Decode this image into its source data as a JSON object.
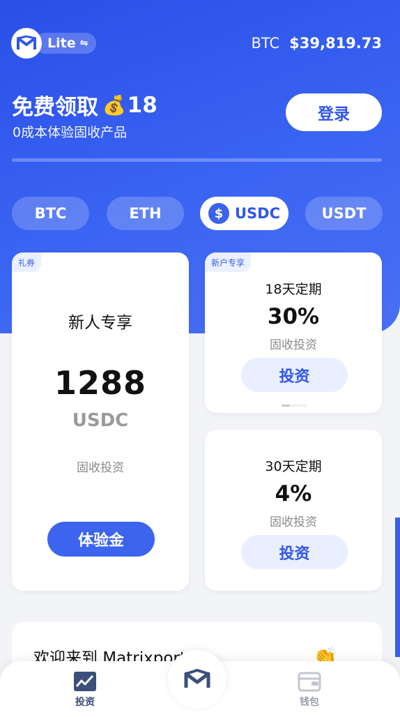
{
  "header": {
    "brand_mode": "Lite",
    "price_symbol": "BTC",
    "price_value": "$39,819.73"
  },
  "promo": {
    "title": "免费领取",
    "amount": "18",
    "subtitle": "0成本体验固收产品",
    "login_label": "登录"
  },
  "coin_tabs": [
    {
      "label": "BTC",
      "active": false
    },
    {
      "label": "ETH",
      "active": false
    },
    {
      "label": "USDC",
      "active": true
    },
    {
      "label": "USDT",
      "active": false
    }
  ],
  "voucher_card": {
    "tag": "礼券",
    "title": "新人专享",
    "amount": "1288",
    "unit": "USDC",
    "type": "固收投资",
    "button": "体验金"
  },
  "products": [
    {
      "tag": "新户专享",
      "term": "18天定期",
      "rate": "30%",
      "type": "固收投资",
      "button": "投资"
    },
    {
      "term": "30天定期",
      "rate": "4%",
      "type": "固收投资",
      "button": "投资"
    }
  ],
  "welcome": {
    "text": "欢迎来到 Matrixport"
  },
  "nav": {
    "invest_label": "投资",
    "wallet_label": "钱包"
  },
  "colors": {
    "primary": "#3157ea",
    "hero_start": "#2a4fe8",
    "invest_btn_bg": "#e9effe"
  },
  "icons": {
    "logo": "matrixport-logo-icon",
    "swap": "swap-arrows-icon",
    "money_bag": "money-bag-icon",
    "usdc": "usdc-coin-icon",
    "invest_nav": "chart-line-icon",
    "wallet_nav": "wallet-icon",
    "clap": "clapping-hands-icon"
  }
}
